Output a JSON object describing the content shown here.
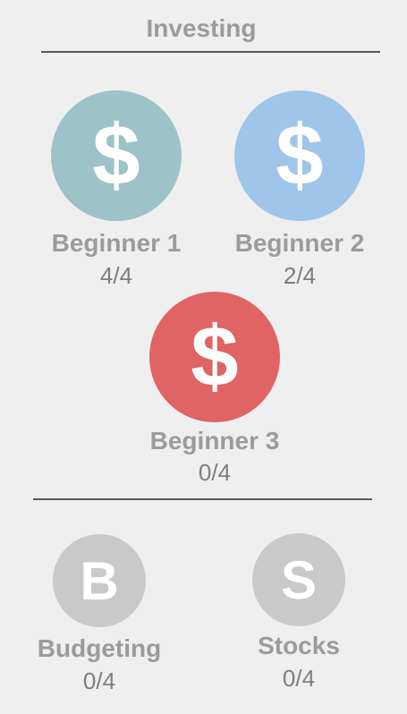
{
  "section": {
    "title": "Investing"
  },
  "colors": {
    "beginner1": "#9dc2c7",
    "beginner2": "#9fc6ea",
    "beginner3": "#e06464",
    "locked": "#c9c9c9",
    "background": "#efefef",
    "label": "#9b9b9b"
  },
  "skills": [
    {
      "name": "Beginner 1",
      "progress": "4/4",
      "icon": "$",
      "icon_name": "dollar-icon"
    },
    {
      "name": "Beginner 2",
      "progress": "2/4",
      "icon": "$",
      "icon_name": "dollar-icon"
    },
    {
      "name": "Beginner 3",
      "progress": "0/4",
      "icon": "$",
      "icon_name": "dollar-icon"
    }
  ],
  "locked_skills": [
    {
      "name": "Budgeting",
      "progress": "0/4",
      "icon": "B",
      "icon_name": "letter-b-icon"
    },
    {
      "name": "Stocks",
      "progress": "0/4",
      "icon": "S",
      "icon_name": "letter-s-icon"
    }
  ]
}
